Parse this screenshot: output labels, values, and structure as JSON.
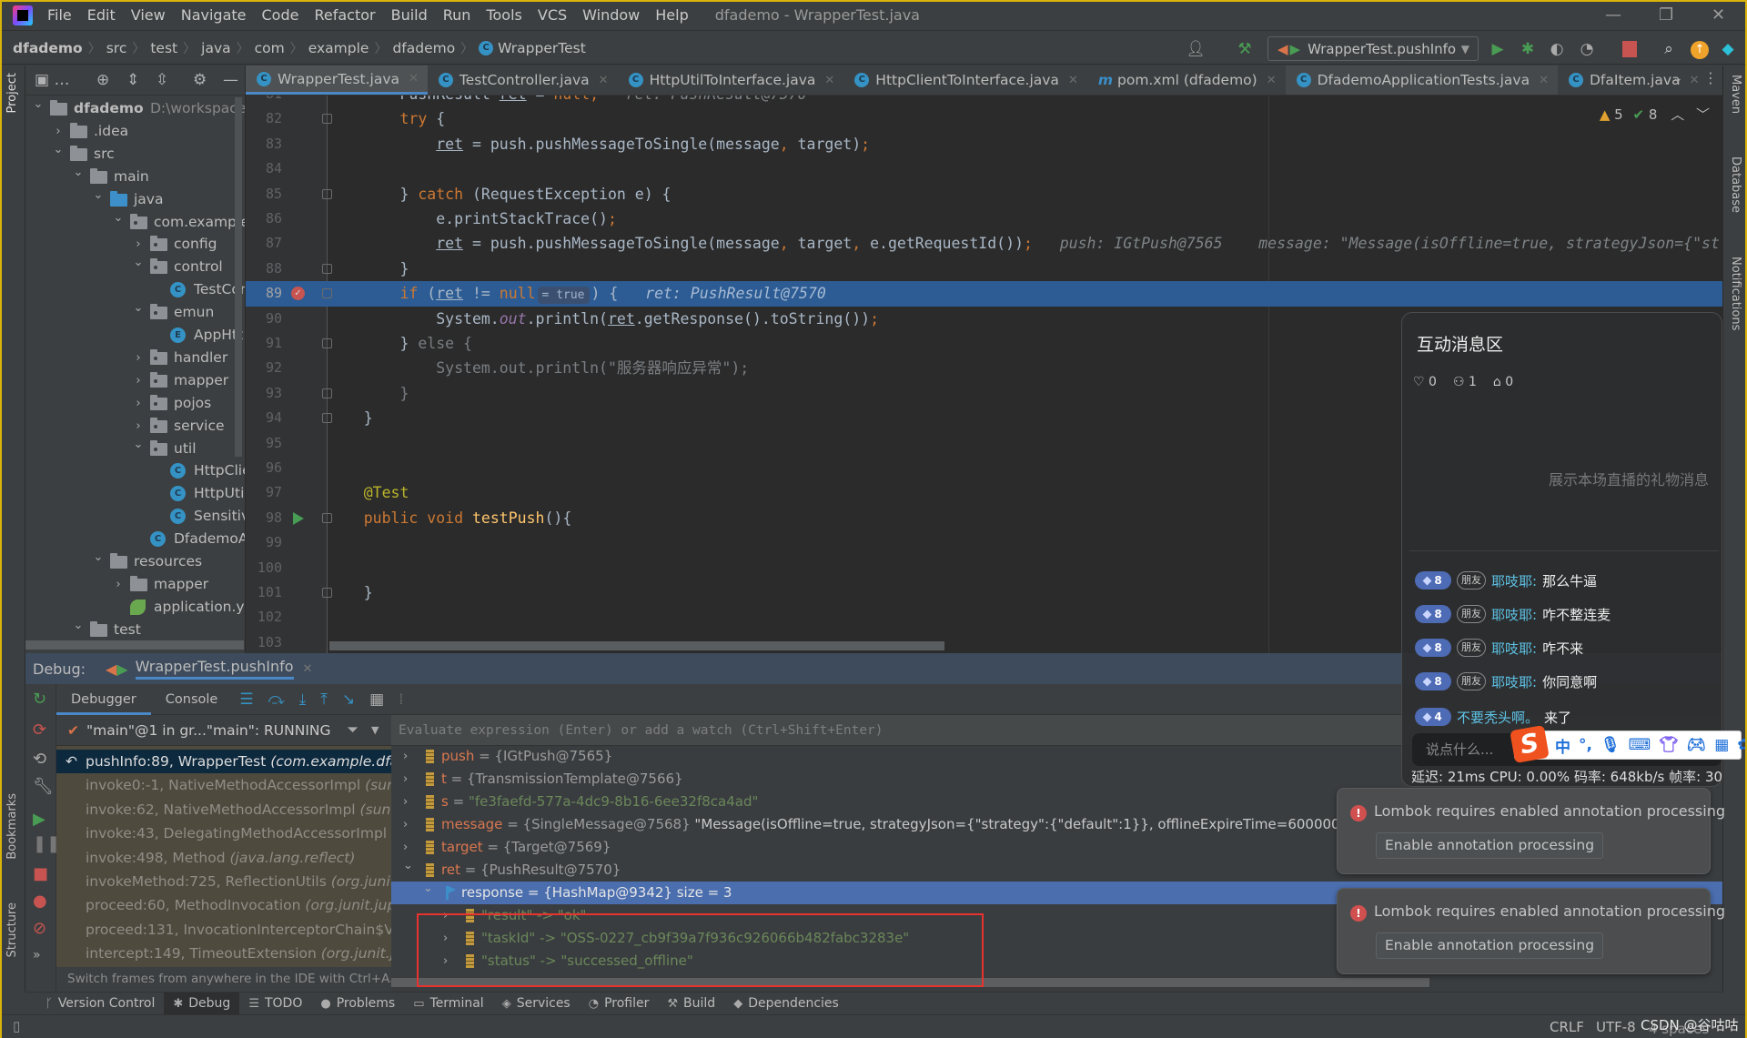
{
  "menubar": {
    "items": [
      "File",
      "Edit",
      "View",
      "Navigate",
      "Code",
      "Refactor",
      "Build",
      "Run",
      "Tools",
      "VCS",
      "Window",
      "Help"
    ],
    "window_title": "dfademo - WrapperTest.java"
  },
  "breadcrumb": [
    "dfademo",
    "src",
    "test",
    "java",
    "com",
    "example",
    "dfademo",
    "WrapperTest"
  ],
  "toolbar": {
    "run_config": "WrapperTest.pushInfo"
  },
  "side_labels": {
    "project": "Project",
    "bookmarks": "Bookmarks",
    "structure": "Structure",
    "maven": "Maven",
    "database": "Database",
    "notifications": "Notifications"
  },
  "project_tree": [
    {
      "label": "dfademo",
      "extra": "D:\\workspace\\d",
      "depth": 0,
      "state": "open",
      "icon": "module"
    },
    {
      "label": ".idea",
      "depth": 1,
      "state": "closed",
      "icon": "folder"
    },
    {
      "label": "src",
      "depth": 1,
      "state": "open",
      "icon": "folder"
    },
    {
      "label": "main",
      "depth": 2,
      "state": "open",
      "icon": "folder"
    },
    {
      "label": "java",
      "depth": 3,
      "state": "open",
      "icon": "src"
    },
    {
      "label": "com.example",
      "depth": 4,
      "state": "open",
      "icon": "pkg"
    },
    {
      "label": "config",
      "depth": 5,
      "state": "closed",
      "icon": "pkg"
    },
    {
      "label": "control",
      "depth": 5,
      "state": "open",
      "icon": "pkg"
    },
    {
      "label": "TestController",
      "depth": 6,
      "icon": "class"
    },
    {
      "label": "emun",
      "depth": 5,
      "state": "open",
      "icon": "pkg"
    },
    {
      "label": "AppHtt",
      "depth": 6,
      "icon": "enum"
    },
    {
      "label": "handler",
      "depth": 5,
      "state": "closed",
      "icon": "pkg"
    },
    {
      "label": "mapper",
      "depth": 5,
      "state": "closed",
      "icon": "pkg"
    },
    {
      "label": "pojos",
      "depth": 5,
      "state": "closed",
      "icon": "pkg"
    },
    {
      "label": "service",
      "depth": 5,
      "state": "closed",
      "icon": "pkg"
    },
    {
      "label": "util",
      "depth": 5,
      "state": "open",
      "icon": "pkg"
    },
    {
      "label": "HttpClientToInterface",
      "depth": 6,
      "icon": "class"
    },
    {
      "label": "HttpUtilToInterface",
      "depth": 6,
      "icon": "class"
    },
    {
      "label": "Sensitiv",
      "depth": 6,
      "icon": "class"
    },
    {
      "label": "DfademoA",
      "depth": 5,
      "icon": "class"
    },
    {
      "label": "resources",
      "depth": 3,
      "state": "open",
      "icon": "folder"
    },
    {
      "label": "mapper",
      "depth": 4,
      "state": "closed",
      "icon": "folder"
    },
    {
      "label": "application.ym",
      "depth": 4,
      "icon": "yml"
    },
    {
      "label": "test",
      "depth": 2,
      "state": "open",
      "icon": "folder"
    }
  ],
  "editor_tabs": [
    {
      "label": "WrapperTest.java",
      "icon": "class",
      "active": true
    },
    {
      "label": "TestController.java",
      "icon": "class"
    },
    {
      "label": "HttpUtilToInterface.java",
      "icon": "class"
    },
    {
      "label": "HttpClientToInterface.java",
      "icon": "class"
    },
    {
      "label": "pom.xml (dfademo)",
      "icon": "maven"
    },
    {
      "label": "DfademoApplicationTests.java",
      "icon": "class",
      "semi": true
    },
    {
      "label": "DfaItem.java",
      "icon": "class"
    }
  ],
  "inspections": {
    "warnings": "5",
    "ok": "8"
  },
  "editor": {
    "current_line": 89,
    "lines": [
      {
        "n": 81,
        "segs": [
          [
            "        PushResult ",
            "p"
          ],
          [
            "ret",
            "u"
          ],
          [
            " = ",
            "p"
          ],
          [
            "null",
            "kw"
          ],
          [
            ";",
            "kw"
          ]
        ],
        "hint": "   ret: PushResult@7570"
      },
      {
        "n": 82,
        "segs": [
          [
            "        ",
            "p"
          ],
          [
            "try",
            "kw"
          ],
          [
            " {",
            "p"
          ]
        ],
        "fold": true
      },
      {
        "n": 83,
        "segs": [
          [
            "            ",
            "p"
          ],
          [
            "ret",
            "u"
          ],
          [
            " = push.pushMessageToSingle(message",
            "p"
          ],
          [
            ", ",
            "kw"
          ],
          [
            "target)",
            "p"
          ],
          [
            ";",
            "kw"
          ]
        ]
      },
      {
        "n": 84,
        "segs": []
      },
      {
        "n": 85,
        "segs": [
          [
            "        } ",
            "p"
          ],
          [
            "catch",
            "kw"
          ],
          [
            " (RequestException e) {",
            "p"
          ]
        ],
        "fold": true
      },
      {
        "n": 86,
        "segs": [
          [
            "            e.printStackTrace()",
            "p"
          ],
          [
            ";",
            "kw"
          ]
        ]
      },
      {
        "n": 87,
        "segs": [
          [
            "            ",
            "p"
          ],
          [
            "ret",
            "u"
          ],
          [
            " = push.pushMessageToSingle(message",
            "p"
          ],
          [
            ", ",
            "kw"
          ],
          [
            "target",
            "p"
          ],
          [
            ", ",
            "kw"
          ],
          [
            "e.getRequestId())",
            "p"
          ],
          [
            ";",
            "kw"
          ]
        ],
        "hint": "   push: IGtPush@7565    message: \"Message(isOffline=true, strategyJson={\"st"
      },
      {
        "n": 88,
        "segs": [
          [
            "        }",
            "p"
          ]
        ],
        "fold": true
      },
      {
        "n": 89,
        "segs": [
          [
            "        ",
            "p"
          ],
          [
            "if",
            "kw"
          ],
          [
            " (",
            "p"
          ],
          [
            "ret",
            "u"
          ],
          [
            " != ",
            "p"
          ],
          [
            "null",
            "kw"
          ]
        ],
        "chip": "= true",
        "after": [
          [
            ") {",
            "p"
          ]
        ],
        "hint": "   ret: PushResult@7570",
        "breakpoint": true,
        "fold": true
      },
      {
        "n": 90,
        "segs": [
          [
            "            System.",
            "p"
          ],
          [
            "out",
            "st"
          ],
          [
            ".println(",
            "p"
          ],
          [
            "ret",
            "u"
          ],
          [
            ".getResponse().toString())",
            "p"
          ],
          [
            ";",
            "kw"
          ]
        ]
      },
      {
        "n": 91,
        "segs": [
          [
            "        } ",
            "p"
          ],
          [
            "else {",
            "dim"
          ]
        ],
        "fold": true
      },
      {
        "n": 92,
        "segs": [
          [
            "            System.out.println(\"服务器响应异常\");",
            "dim"
          ]
        ]
      },
      {
        "n": 93,
        "segs": [
          [
            "        }",
            "dim"
          ]
        ],
        "fold": true
      },
      {
        "n": 94,
        "segs": [
          [
            "    }",
            "p"
          ]
        ],
        "fold": true
      },
      {
        "n": 95,
        "segs": []
      },
      {
        "n": 96,
        "segs": []
      },
      {
        "n": 97,
        "segs": [
          [
            "    ",
            "p"
          ],
          [
            "@Test",
            "ann"
          ]
        ]
      },
      {
        "n": 98,
        "segs": [
          [
            "    ",
            "p"
          ],
          [
            "public void ",
            "kw"
          ],
          [
            "testPush",
            "fn"
          ],
          [
            "(){",
            "p"
          ]
        ],
        "run": true,
        "fold": true
      },
      {
        "n": 99,
        "segs": []
      },
      {
        "n": 100,
        "segs": []
      },
      {
        "n": 101,
        "segs": [
          [
            "    }",
            "p"
          ]
        ],
        "fold": true
      },
      {
        "n": 102,
        "segs": []
      },
      {
        "n": 103,
        "segs": []
      }
    ]
  },
  "debug": {
    "label": "Debug:",
    "session": "WrapperTest.pushInfo",
    "tabs": [
      "Debugger",
      "Console"
    ],
    "thread": "\"main\"@1 in gr...\"main\": RUNNING",
    "eval_placeholder": "Evaluate expression (Enter) or add a watch (Ctrl+Shift+Enter)",
    "frames": [
      {
        "m": "pushInfo:89, WrapperTest ",
        "c": "(com.example.dfac",
        "sel": true
      },
      {
        "m": "invoke0:-1, NativeMethodAccessorImpl ",
        "c": "(sun.r"
      },
      {
        "m": "invoke:62, NativeMethodAccessorImpl ",
        "c": "(sun.re"
      },
      {
        "m": "invoke:43, DelegatingMethodAccessorImpl ",
        "c": "(s"
      },
      {
        "m": "invoke:498, Method ",
        "c": "(java.lang.reflect)"
      },
      {
        "m": "invokeMethod:725, ReflectionUtils ",
        "c": "(org.junit.j"
      },
      {
        "m": "proceed:60, MethodInvocation ",
        "c": "(org.junit.jupi"
      },
      {
        "m": "proceed:131, InvocationInterceptorChain$Val",
        "c": ""
      },
      {
        "m": "intercept:149, TimeoutExtension ",
        "c": "(org.junit.jup"
      }
    ],
    "frames_hint": "Switch frames from anywhere in the IDE with Ctrl+A..",
    "variables": [
      {
        "name": "push",
        "value": "{IGtPush@7565}",
        "depth": 0,
        "exp": false
      },
      {
        "name": "t",
        "value": "{TransmissionTemplate@7566}",
        "depth": 0,
        "exp": false
      },
      {
        "name": "s",
        "str": "\"fe3faefd-577a-4dc9-8b16-6ee32f8ca4ad\"",
        "depth": 0,
        "exp": false
      },
      {
        "name": "message",
        "value": "{SingleMessage@7568}",
        "light": " \"Message(isOffline=true, strategyJson={\"strategy\":{\"default\":1}}, offlineExpireTime=600000, pushNe",
        "depth": 0,
        "exp": false
      },
      {
        "name": "target",
        "value": "{Target@7569}",
        "depth": 0,
        "exp": false
      },
      {
        "name": "ret",
        "value": "{PushResult@7570}",
        "depth": 0,
        "exp": true
      },
      {
        "name": "response",
        "value": "{HashMap@9342}  size = 3",
        "depth": 1,
        "exp": true,
        "sel": true,
        "flag": true
      },
      {
        "entry": "\"result\" -> \"ok\"",
        "depth": 2,
        "exp": false
      },
      {
        "entry": "\"taskId\" -> \"OSS-0227_cb9f39a7f936c926066b482fabc3283e\"",
        "depth": 2,
        "exp": false
      },
      {
        "entry": "\"status\" -> \"successed_offline\"",
        "depth": 2,
        "exp": false
      }
    ]
  },
  "notifications": [
    {
      "message": "Lombok requires enabled annotation processing",
      "action": "Enable annotation processing"
    },
    {
      "message": "Lombok requires enabled annotation processing",
      "action": "Enable annotation processing"
    }
  ],
  "chat": {
    "title": "互动消息区",
    "likes": "0",
    "viewers": "1",
    "gifts": "0",
    "empty_gift_text": "展示本场直播的礼物消息",
    "messages": [
      {
        "level": "8",
        "friend": "朋友",
        "name": "耶吱耶:",
        "text": "那么牛逼"
      },
      {
        "level": "8",
        "friend": "朋友",
        "name": "耶吱耶:",
        "text": "咋不整连麦"
      },
      {
        "level": "8",
        "friend": "朋友",
        "name": "耶吱耶:",
        "text": "咋不来"
      },
      {
        "level": "8",
        "friend": "朋友",
        "name": "耶吱耶:",
        "text": "你同意啊"
      },
      {
        "level": "4",
        "name": "不要秃头啊。",
        "text": "来了"
      }
    ],
    "input_placeholder": "说点什么...",
    "metrics": "延迟: 21ms    CPU: 0.00%    码率: 648kb/s    帧率: 30"
  },
  "ime": {
    "logo": "S",
    "items": [
      "中",
      "°,"
    ]
  },
  "tool_windows": [
    {
      "label": "Version Control",
      "icon": "branch"
    },
    {
      "label": "Debug",
      "icon": "bug",
      "active": true
    },
    {
      "label": "TODO",
      "icon": "list"
    },
    {
      "label": "Problems",
      "icon": "warning"
    },
    {
      "label": "Terminal",
      "icon": "terminal"
    },
    {
      "label": "Services",
      "icon": "services"
    },
    {
      "label": "Profiler",
      "icon": "profiler"
    },
    {
      "label": "Build",
      "icon": "hammer"
    },
    {
      "label": "Dependencies",
      "icon": "dependencies"
    }
  ],
  "status": {
    "line_sep": "CRLF",
    "encoding": "UTF-8",
    "indent": "4 spaces",
    "watermark": "CSDN @谷咕咕"
  },
  "colors": {
    "accent": "#4a88c7",
    "execution_line": "#2d5c94",
    "selection": "#4b6eaf",
    "highlight_box": "#e8322e",
    "frame": "#d8b30a"
  }
}
